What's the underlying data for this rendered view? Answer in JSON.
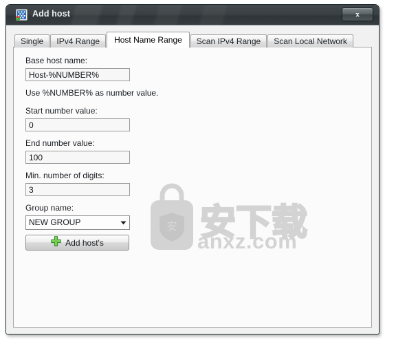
{
  "window": {
    "title": "Add host",
    "icon": "app-icon",
    "close_label": "x"
  },
  "tabs": [
    {
      "label": "Single",
      "active": false
    },
    {
      "label": "IPv4 Range",
      "active": false
    },
    {
      "label": "Host Name Range",
      "active": true
    },
    {
      "label": "Scan IPv4 Range",
      "active": false
    },
    {
      "label": "Scan Local Network",
      "active": false
    }
  ],
  "form": {
    "base_host_name": {
      "label": "Base host name:",
      "value": "Host-%NUMBER%",
      "placeholder": ""
    },
    "hint": "Use %NUMBER% as number value.",
    "start_number": {
      "label": "Start number value:",
      "value": "0",
      "placeholder": ""
    },
    "end_number": {
      "label": "End number value:",
      "value": "100",
      "placeholder": ""
    },
    "min_digits": {
      "label": "Min. number of digits:",
      "value": "3",
      "placeholder": ""
    },
    "group_name": {
      "label": "Group name:",
      "value": "NEW GROUP",
      "placeholder": "",
      "caret_icon": "chevron-down-icon"
    }
  },
  "actions": {
    "add_hosts": {
      "label": "Add host's",
      "icon": "green-plus-icon"
    }
  },
  "watermark": {
    "text": "anxz.com",
    "cjk": "安下载",
    "badge_char": "安",
    "color": "#d3d3d3"
  },
  "colors": {
    "titlebar": "#3a4043",
    "accent_green": "#5bc236",
    "window_bg": "#f1f1f1",
    "page_bg": "#fbfbfb",
    "text": "#1b1f24"
  }
}
